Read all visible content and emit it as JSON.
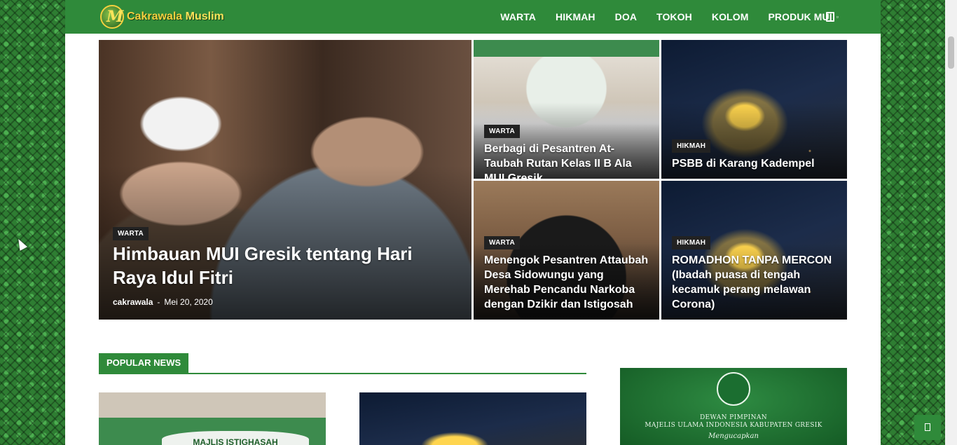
{
  "header": {
    "logo_text_1": "Cakrawala",
    "logo_text_2": "Muslim",
    "nav": [
      "WARTA",
      "HIKMAH",
      "DOA",
      "TOKOH",
      "KOLOM",
      "PRODUK MUI"
    ],
    "produk_caret_icon": "square-icon",
    "search_icon": "search-icon"
  },
  "hero": [
    {
      "category": "WARTA",
      "title": "Himbauan MUI Gresik tentang Hari Raya Idul Fitri",
      "author": "cakrawala",
      "separator": "-",
      "date": "Mei 20, 2020"
    },
    {
      "category": "WARTA",
      "title": "Berbagi di Pesantren At-Taubah Rutan Kelas II B Ala MUI Gresik"
    },
    {
      "category": "HIKMAH",
      "title": "PSBB di Karang Kadempel"
    },
    {
      "category": "WARTA",
      "title": "Menengok Pesantren Attaubah Desa Sidowungu yang Merehab Pencandu Narkoba dengan Dzikir dan Istigosah"
    },
    {
      "category": "HIKMAH",
      "title": "ROMADHON TANPA MERCON (Ibadah puasa di tengah kecamuk perang melawan Corona)"
    }
  ],
  "popular": {
    "heading": "POPULAR NEWS",
    "thumb_banner_1": "MAJLIS ISTIGHASAH"
  },
  "ad": {
    "line1": "DEWAN PIMPINAN",
    "line2": "MAJELIS ULAMA INDONESIA KABUPATEN GRESIK",
    "line3": "Mengucapkan"
  },
  "colors": {
    "brand_green": "#2f8a3a",
    "logo_yellow": "#f4d03f"
  }
}
